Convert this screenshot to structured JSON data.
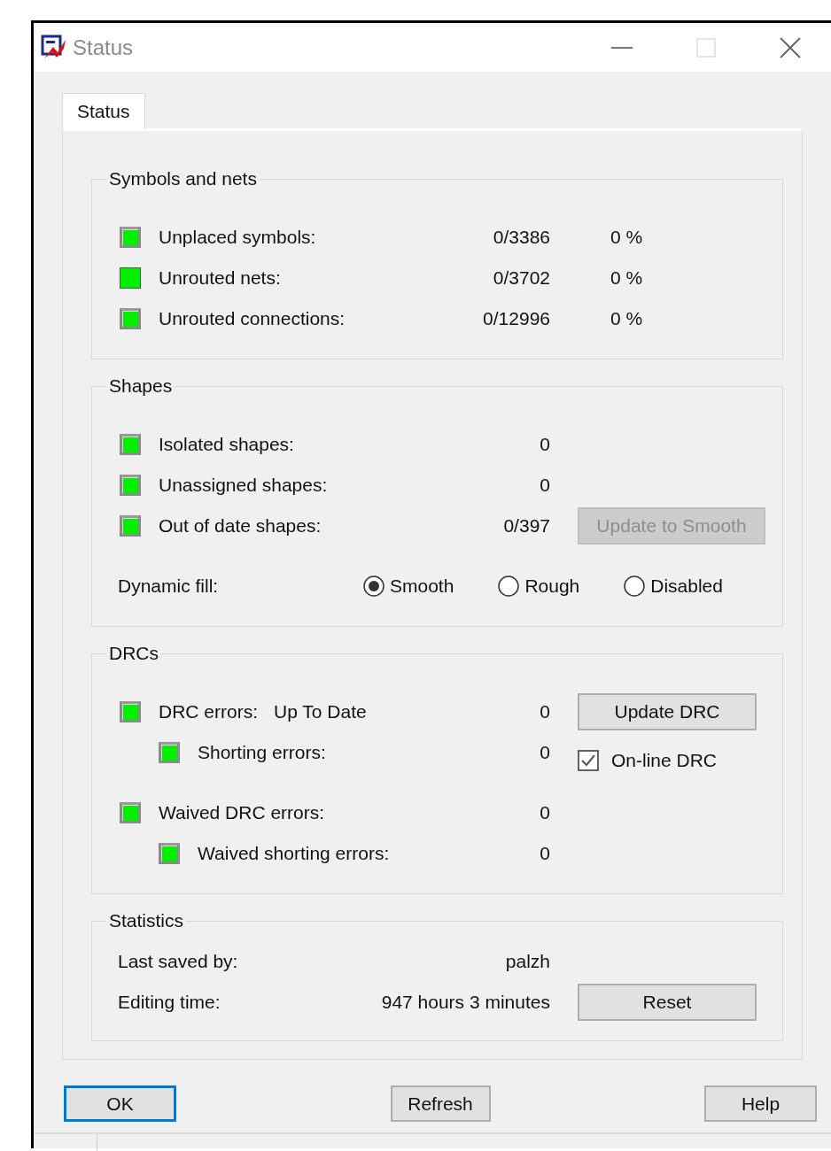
{
  "window": {
    "title": "Status"
  },
  "tabs": [
    {
      "label": "Status",
      "selected": true
    }
  ],
  "symbols_and_nets": {
    "title": "Symbols and nets",
    "rows": [
      {
        "label": "Unplaced symbols:",
        "value": "0/3386",
        "percent": "0 %",
        "kind": "raised"
      },
      {
        "label": "Unrouted nets:",
        "value": "0/3702",
        "percent": "0 %",
        "kind": "flat"
      },
      {
        "label": "Unrouted connections:",
        "value": "0/12996",
        "percent": "0 %",
        "kind": "raised"
      }
    ]
  },
  "shapes": {
    "title": "Shapes",
    "rows": [
      {
        "label": "Isolated shapes:",
        "value": "0",
        "kind": "raised"
      },
      {
        "label": "Unassigned shapes:",
        "value": "0",
        "kind": "raised"
      },
      {
        "label": "Out of date shapes:",
        "value": "0/397",
        "kind": "raised"
      }
    ],
    "update_button": {
      "label": "Update to Smooth",
      "disabled": true
    },
    "dynamic_fill": {
      "label": "Dynamic fill:",
      "options": [
        {
          "label": "Smooth",
          "selected": true
        },
        {
          "label": "Rough",
          "selected": false
        },
        {
          "label": "Disabled",
          "selected": false
        }
      ]
    }
  },
  "drcs": {
    "title": "DRCs",
    "rows": [
      {
        "label": "DRC errors:",
        "status": "Up To Date",
        "value": "0",
        "kind": "raised",
        "children": [
          {
            "label": "Shorting errors:",
            "value": "0",
            "kind": "raised"
          }
        ]
      },
      {
        "label": "Waived DRC errors:",
        "value": "0",
        "kind": "raised",
        "children": [
          {
            "label": "Waived shorting errors:",
            "value": "0",
            "kind": "raised"
          }
        ]
      }
    ],
    "update_button": {
      "label": "Update DRC",
      "disabled": false
    },
    "online_drc": {
      "label": "On-line DRC",
      "checked": true
    }
  },
  "statistics": {
    "title": "Statistics",
    "rows": [
      {
        "label": "Last saved by:",
        "value": "palzh"
      },
      {
        "label": "Editing time:",
        "value": "947 hours 3 minutes"
      }
    ],
    "reset_button": "Reset"
  },
  "buttons": [
    {
      "label": "OK",
      "default": true
    },
    {
      "label": "Refresh",
      "default": false
    },
    {
      "label": "Help",
      "default": false
    }
  ]
}
